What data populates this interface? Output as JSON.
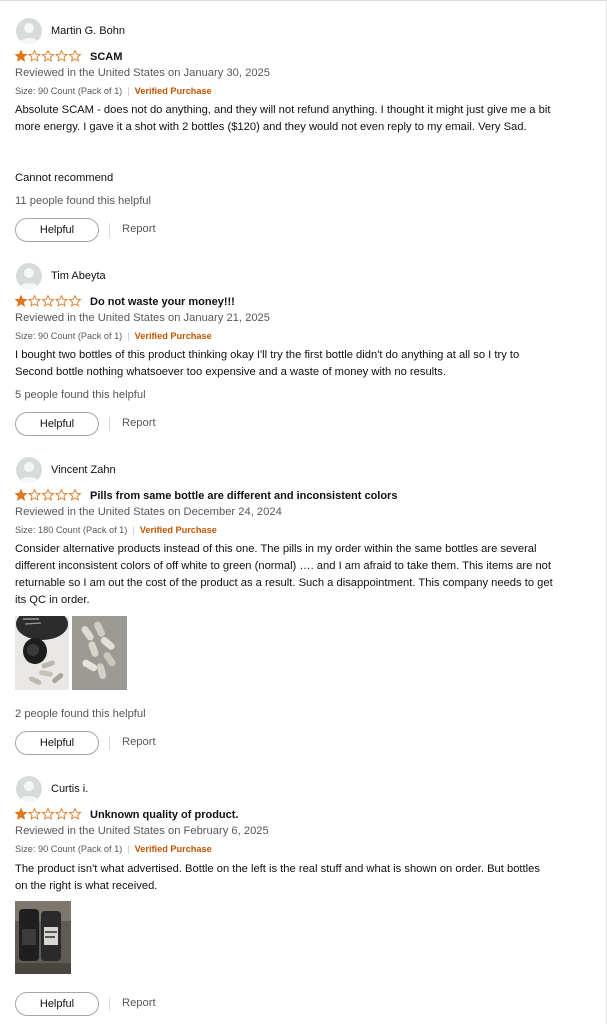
{
  "reviews": [
    {
      "author": "Martin G. Bohn",
      "rating": 1,
      "title": "SCAM",
      "reviewed": "Reviewed in the United States on January 30, 2025",
      "size": "Size: 90 Count (Pack of 1)",
      "verified": "Verified Purchase",
      "body": "Absolute SCAM - does not do anything, and they will not refund anything. I thought it might just give me a bit more energy. I gave it a shot with 2 bottles ($120) and they would not even reply to my email. Very Sad.",
      "body2": "Cannot recommend",
      "helpful_count": "11 people found this helpful",
      "helpful_label": "Helpful",
      "report_label": "Report"
    },
    {
      "author": "Tim Abeyta",
      "rating": 1,
      "title": "Do not waste your money!!!",
      "reviewed": "Reviewed in the United States on January 21, 2025",
      "size": "Size: 90 Count (Pack of 1)",
      "verified": "Verified Purchase",
      "body": "I bought two bottles of this product thinking okay I'll try the first bottle didn't do anything at all so I try to Second bottle nothing whatsoever too expensive and a waste of money with no results.",
      "helpful_count": "5 people found this helpful",
      "helpful_label": "Helpful",
      "report_label": "Report"
    },
    {
      "author": "Vincent Zahn",
      "rating": 1,
      "title": "Pills from same bottle are different and inconsistent colors",
      "reviewed": "Reviewed in the United States on December 24, 2024",
      "size": "Size: 180 Count (Pack of 1)",
      "verified": "Verified Purchase",
      "body": "Consider alternative products instead of this one. The pills in my order within the same bottles are several different inconsistent colors of off white to green (normal) …. and I am afraid to take them. This items are not returnable so I am out the cost of the product as a result. Such a disappointment. This company needs to get its QC in order.",
      "helpful_count": "2 people found this helpful",
      "helpful_label": "Helpful",
      "report_label": "Report"
    },
    {
      "author": "Curtis i.",
      "rating": 1,
      "title": "Unknown quality of product.",
      "reviewed": "Reviewed in the United States on February 6, 2025",
      "size": "Size: 90 Count (Pack of 1)",
      "verified": "Verified Purchase",
      "body": "The product isn't what advertised. Bottle on the left is the real stuff and what is shown on order. But bottles on the right is what received.",
      "helpful_label": "Helpful",
      "report_label": "Report"
    }
  ],
  "colors": {
    "star_fill": "#de7921",
    "star_outline": "#de7921",
    "verified": "#c45500",
    "secondary_text": "#565959"
  }
}
